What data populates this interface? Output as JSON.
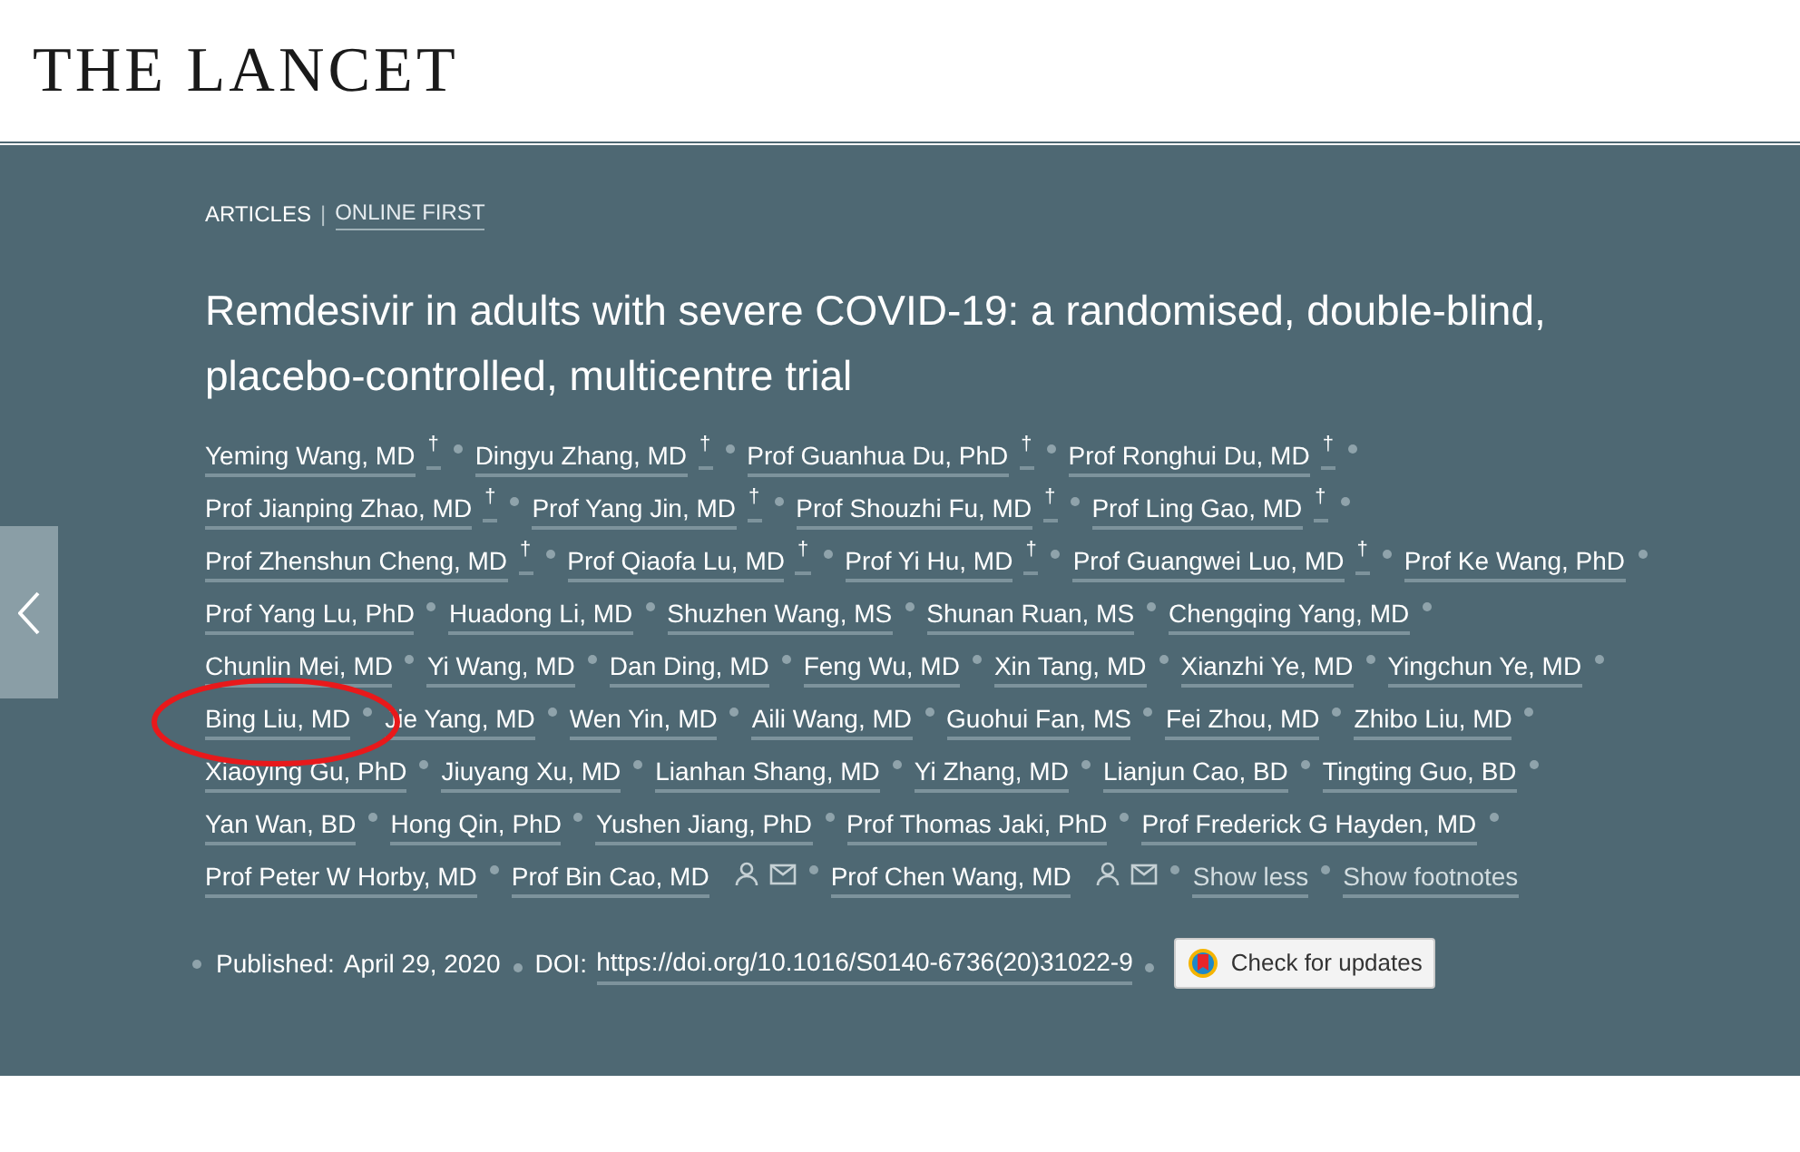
{
  "logo": "THE LANCET",
  "breadcrumb": {
    "section": "ARTICLES",
    "separator": "|",
    "status": "ONLINE FIRST"
  },
  "title": "Remdesivir in adults with severe COVID-19: a randomised, double-blind, placebo-controlled, multicentre trial",
  "author_rows": [
    [
      {
        "name": "Yeming Wang, MD",
        "dagger": true
      },
      {
        "name": "Dingyu Zhang, MD",
        "dagger": true
      },
      {
        "name": "Prof Guanhua Du, PhD",
        "dagger": true
      },
      {
        "name": "Prof Ronghui Du, MD",
        "dagger": true
      }
    ],
    [
      {
        "name": "Prof Jianping Zhao, MD",
        "dagger": true
      },
      {
        "name": "Prof Yang Jin, MD",
        "dagger": true
      },
      {
        "name": "Prof Shouzhi Fu, MD",
        "dagger": true
      },
      {
        "name": "Prof Ling Gao, MD",
        "dagger": true
      }
    ],
    [
      {
        "name": "Prof Zhenshun Cheng, MD",
        "dagger": true
      },
      {
        "name": "Prof Qiaofa Lu, MD",
        "dagger": true
      },
      {
        "name": "Prof Yi Hu, MD",
        "dagger": true
      },
      {
        "name": "Prof Guangwei Luo, MD",
        "dagger": true
      },
      {
        "name": "Prof Ke Wang, PhD",
        "dagger": false
      }
    ],
    [
      {
        "name": "Prof Yang Lu, PhD",
        "dagger": false
      },
      {
        "name": "Huadong Li, MD",
        "dagger": false
      },
      {
        "name": "Shuzhen Wang, MS",
        "dagger": false
      },
      {
        "name": "Shunan Ruan, MS",
        "dagger": false
      },
      {
        "name": "Chengqing Yang, MD",
        "dagger": false
      }
    ],
    [
      {
        "name": "Chunlin Mei, MD",
        "dagger": false
      },
      {
        "name": "Yi Wang, MD",
        "dagger": false
      },
      {
        "name": "Dan Ding, MD",
        "dagger": false
      },
      {
        "name": "Feng Wu, MD",
        "dagger": false
      },
      {
        "name": "Xin Tang, MD",
        "dagger": false
      },
      {
        "name": "Xianzhi Ye, MD",
        "dagger": false
      },
      {
        "name": "Yingchun Ye, MD",
        "dagger": false
      }
    ],
    [
      {
        "name": "Bing Liu, MD",
        "dagger": false
      },
      {
        "name": "Jie Yang, MD",
        "dagger": false
      },
      {
        "name": "Wen Yin, MD",
        "dagger": false
      },
      {
        "name": "Aili Wang, MD",
        "dagger": false
      },
      {
        "name": "Guohui Fan, MS",
        "dagger": false
      },
      {
        "name": "Fei Zhou, MD",
        "dagger": false
      },
      {
        "name": "Zhibo Liu, MD",
        "dagger": false
      }
    ],
    [
      {
        "name": "Xiaoying Gu, PhD",
        "dagger": false
      },
      {
        "name": "Jiuyang Xu, MD",
        "dagger": false
      },
      {
        "name": "Lianhan Shang, MD",
        "dagger": false
      },
      {
        "name": "Yi Zhang, MD",
        "dagger": false
      },
      {
        "name": "Lianjun Cao, BD",
        "dagger": false
      },
      {
        "name": "Tingting Guo, BD",
        "dagger": false
      }
    ],
    [
      {
        "name": "Yan Wan, BD",
        "dagger": false
      },
      {
        "name": "Hong Qin, PhD",
        "dagger": false
      },
      {
        "name": "Yushen Jiang, PhD",
        "dagger": false
      },
      {
        "name": "Prof Thomas Jaki, PhD",
        "dagger": false
      },
      {
        "name": "Prof Frederick G Hayden, MD",
        "dagger": false
      }
    ],
    [
      {
        "name": "Prof Peter W Horby, MD",
        "dagger": false
      },
      {
        "name": "Prof Bin Cao, MD",
        "dagger": false,
        "contact": true
      },
      {
        "name": "Prof Chen Wang, MD",
        "dagger": false,
        "contact": true
      }
    ]
  ],
  "dagger_mark": "†",
  "author_links": [
    "Show less",
    "Show footnotes"
  ],
  "published": {
    "label": "Published:",
    "date": "April 29, 2020"
  },
  "doi": {
    "label": "DOI:",
    "link": "https://doi.org/10.1016/S0140-6736(20)31022-9"
  },
  "update_button": "Check for updates",
  "annotation": {
    "kind": "ellipse",
    "color": "#e8191b"
  }
}
